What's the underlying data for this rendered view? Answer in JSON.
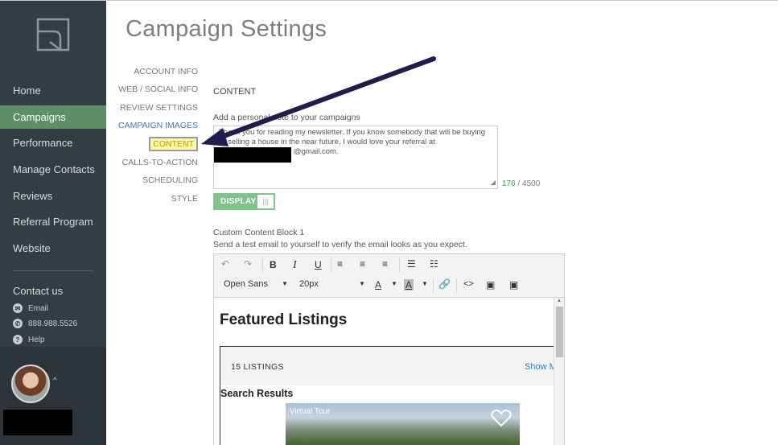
{
  "sidebar": {
    "nav": [
      {
        "label": "Home"
      },
      {
        "label": "Campaigns"
      },
      {
        "label": "Performance"
      },
      {
        "label": "Manage Contacts"
      },
      {
        "label": "Reviews"
      },
      {
        "label": "Referral Program"
      },
      {
        "label": "Website"
      }
    ],
    "active_item": "Campaigns",
    "contact_title": "Contact us",
    "contact_email": "Email",
    "contact_phone": "888.988.5526",
    "contact_help": "Help"
  },
  "page": {
    "title": "Campaign Settings"
  },
  "subnav": [
    {
      "label": "ACCOUNT INFO"
    },
    {
      "label": "WEB / SOCIAL INFO"
    },
    {
      "label": "REVIEW SETTINGS"
    },
    {
      "label": "CAMPAIGN IMAGES"
    },
    {
      "label": "CONTENT"
    },
    {
      "label": "CALLS-TO-ACTION"
    },
    {
      "label": "SCHEDULING"
    },
    {
      "label": "STYLE"
    }
  ],
  "content": {
    "section_label": "CONTENT",
    "note_label": "Add a personal note to your campaigns",
    "note_text_line1": "Thank you for reading my newsletter. If you know somebody that will be buying",
    "note_text_line2": "or selling a house in the near future, I would love your referral at",
    "note_text_line3": "@gmail.com.",
    "char_count": "176",
    "char_limit": "/ 4500",
    "toggle_label": "DISPLAY",
    "toggle_state": "on"
  },
  "custom_block": {
    "title": "Custom Content Block 1",
    "subtitle": "Send a test email to yourself to verify the email looks as you expect.",
    "toolbar": {
      "font_family": "Open Sans",
      "font_size": "20px"
    },
    "body": {
      "heading": "Featured Listings",
      "listing_count": "15 LISTINGS",
      "show_more": "Show M",
      "search_results": "Search Results",
      "photo_caption": "Virtual Tour"
    }
  },
  "colors": {
    "sidebar_bg": "#343d43",
    "active_nav": "#5e8f66",
    "accent_blue": "#3b7ab8",
    "toggle_green": "#7fc48b",
    "arrow": "#1f1d4a"
  }
}
